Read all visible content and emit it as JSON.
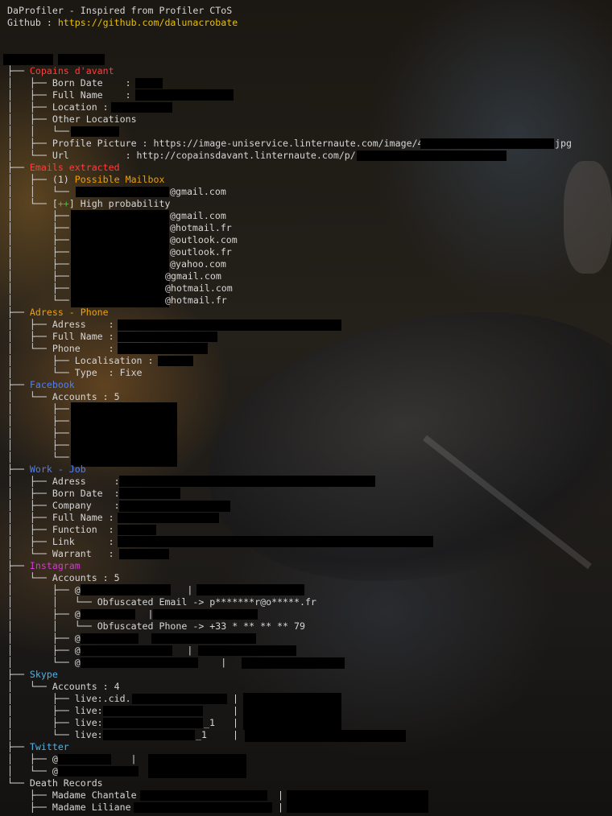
{
  "header": {
    "title": "DaProfiler - Inspired from Profiler CToS",
    "github_label": "Github : ",
    "github_url": "https://github.com/dalunacrobate"
  },
  "tree": {
    "copains": {
      "section": "Copains d'avant",
      "born_date": "Born Date    :",
      "full_name": "Full Name    :",
      "location": "Location :",
      "other_locations": "Other Locations",
      "profile_picture": "Profile Picture : https://image-uniservice.linternaute.com/image/4",
      "profile_picture_ext": "jpg",
      "url": "Url          : http://copainsdavant.linternaute.com/p/"
    },
    "emails": {
      "section": "Emails extracted",
      "possible_count": "(1)",
      "possible_label": "Possible Mailbox",
      "possible_item": "@gmail.com",
      "high_prefix": "[++]",
      "high_label": "High probability",
      "high_items": [
        "@gmail.com",
        "@hotmail.fr",
        "@outlook.com",
        "@outlook.fr",
        "@yahoo.com",
        "@gmail.com",
        "@hotmail.com",
        "@hotmail.fr"
      ]
    },
    "address": {
      "section": "Adress - Phone",
      "adress": "Adress    :",
      "full_name": "Full Name :",
      "phone": "Phone     :",
      "localisation": "Localisation :",
      "type": "Type  : Fixe"
    },
    "facebook": {
      "section": "Facebook",
      "accounts": "Accounts : 5"
    },
    "work": {
      "section": "Work - Job",
      "adress": "Adress     :",
      "born_date": "Born Date  :",
      "company": "Company    :",
      "full_name": "Full Name :",
      "function": "Function  :",
      "link": "Link      :",
      "warrant": "Warrant   :"
    },
    "instagram": {
      "section": "Instagram",
      "accounts": "Accounts : 5",
      "obf_email": "Obfuscated Email -> p*******r@o*****.fr",
      "obf_phone": "Obfuscated Phone -> +33 * ** ** ** 79"
    },
    "skype": {
      "section": "Skype",
      "accounts": "Accounts : 4",
      "items": [
        "live:.cid.",
        "live:",
        "live:",
        "live:"
      ],
      "suffix3": "_1",
      "suffix4": "_1"
    },
    "twitter": {
      "section": "Twitter"
    },
    "death": {
      "section": "Death Records",
      "items": [
        "Madame Chantale",
        "Madame Liliane"
      ]
    }
  }
}
